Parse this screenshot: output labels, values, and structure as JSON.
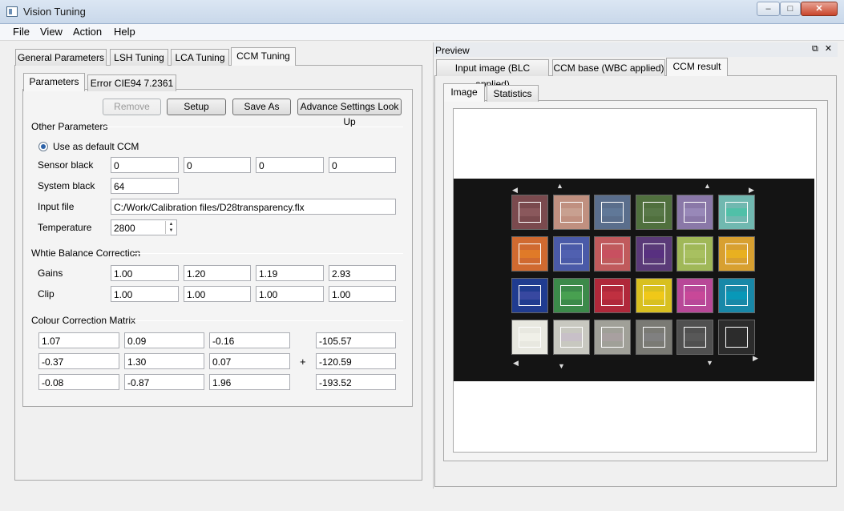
{
  "window": {
    "title": "Vision Tuning",
    "min": "–",
    "max": "□",
    "close": "✕"
  },
  "menu": [
    "File",
    "View",
    "Action",
    "Help"
  ],
  "left_tabs": [
    "General Parameters",
    "LSH Tuning",
    "LCA Tuning",
    "CCM Tuning"
  ],
  "sub_tabs": [
    "Parameters",
    "Error CIE94 7.2361"
  ],
  "buttons": {
    "remove": "Remove",
    "setup": "Setup",
    "save_as": "Save As",
    "advance": "Advance Settings Look Up"
  },
  "other_params": {
    "title": "Other Parameters",
    "default_ccm": "Use as default CCM",
    "sensor_black_label": "Sensor black",
    "sensor_black": [
      "0",
      "0",
      "0",
      "0"
    ],
    "system_black_label": "System black",
    "system_black": "64",
    "input_file_label": "Input file",
    "input_file": "C:/Work/Calibration files/D28transparency.flx",
    "temperature_label": "Temperature",
    "temperature": "2800"
  },
  "wb": {
    "title": "Whtie Balance Correction",
    "gains_label": "Gains",
    "gains": [
      "1.00",
      "1.20",
      "1.19",
      "2.93"
    ],
    "clip_label": "Clip",
    "clip": [
      "1.00",
      "1.00",
      "1.00",
      "1.00"
    ]
  },
  "ccm": {
    "title": "Colour Correction Matrix",
    "matrix": [
      [
        "1.07",
        "0.09",
        "-0.16"
      ],
      [
        "-0.37",
        "1.30",
        "0.07"
      ],
      [
        "-0.08",
        "-0.87",
        "1.96"
      ]
    ],
    "plus": "+",
    "offsets": [
      "-105.57",
      "-120.59",
      "-193.52"
    ]
  },
  "preview": {
    "title": "Preview",
    "dock_icons": [
      "restore-icon",
      "close-icon"
    ],
    "tabs": [
      "Input image (BLC applied)",
      "CCM base (WBC applied)",
      "CCM result"
    ],
    "sub_tabs": [
      "Image",
      "Statistics"
    ]
  },
  "colors": {
    "patches": [
      [
        "#7a4a4e",
        "#c09080",
        "#5a6e8c",
        "#50703e",
        "#8a78a8",
        "#70b8b0"
      ],
      [
        "#d06a30",
        "#4a5aa8",
        "#c05a5c",
        "#5a3a78",
        "#a0b858",
        "#d8a030"
      ],
      [
        "#203c90",
        "#3c8a4a",
        "#b0283a",
        "#d8c020",
        "#b84898",
        "#1888a8"
      ],
      [
        "#e8e8e0",
        "#c8c8c0",
        "#a0a098",
        "#7a7a74",
        "#505050",
        "#2c2c2c"
      ]
    ],
    "roi_fill": [
      [
        "#8a585c",
        "#c8a090",
        "#607898",
        "#587848",
        "#9888b8",
        "#50c0a8"
      ],
      [
        "#e07a28",
        "#5060b0",
        "#c85060",
        "#583080",
        "#a8c060",
        "#e8b020"
      ],
      [
        "#3848a0",
        "#48a050",
        "#c03040",
        "#f0c818",
        "#c84898",
        "#0898b8"
      ],
      [
        "#f0f0e8",
        "#c8c0c8",
        "#a8a0a0",
        "#808080",
        "#585858",
        "#2c2c2c"
      ]
    ]
  }
}
